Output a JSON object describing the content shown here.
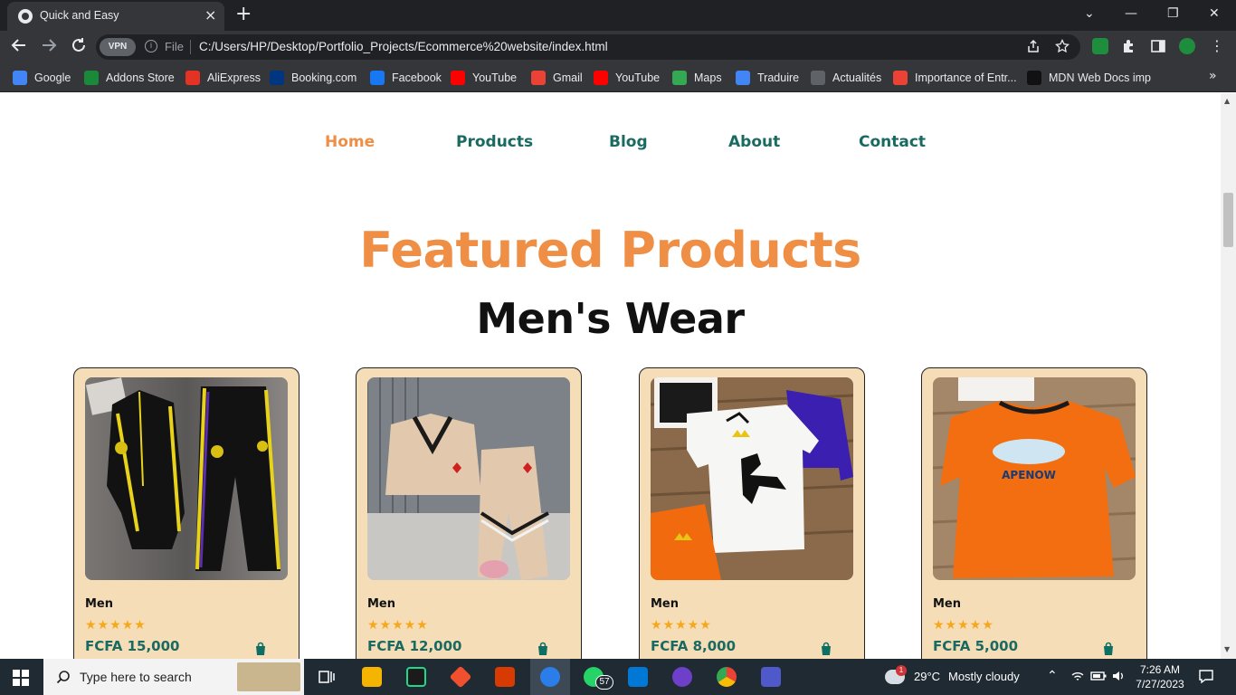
{
  "browser": {
    "tab_title": "Quick and Easy",
    "tab_close": "×",
    "new_tab": "+",
    "win_min": "—",
    "win_restore": "❐",
    "win_close": "✕",
    "win_dropdown": "⌄",
    "vpn": "VPN",
    "file_label": "File",
    "url": "C:/Users/HP/Desktop/Portfolio_Projects/Ecommerce%20website/index.html",
    "more_bookmarks": "»"
  },
  "bookmarks": [
    {
      "label": "Google",
      "icon": "google-icon",
      "color": "#4285f4"
    },
    {
      "label": "Addons Store",
      "icon": "addons-store-icon",
      "color": "#1a8a3a"
    },
    {
      "label": "AliExpress",
      "icon": "aliexpress-icon",
      "color": "#e43225"
    },
    {
      "label": "Booking.com",
      "icon": "booking-icon",
      "color": "#003580"
    },
    {
      "label": "Facebook",
      "icon": "facebook-icon",
      "color": "#1877f2"
    },
    {
      "label": "YouTube",
      "icon": "youtube-icon",
      "color": "#ff0000"
    },
    {
      "label": "Gmail",
      "icon": "gmail-icon",
      "color": "#ea4335"
    },
    {
      "label": "YouTube",
      "icon": "youtube-icon",
      "color": "#ff0000"
    },
    {
      "label": "Maps",
      "icon": "maps-icon",
      "color": "#34a853"
    },
    {
      "label": "Traduire",
      "icon": "translate-icon",
      "color": "#4285f4"
    },
    {
      "label": "Actualités",
      "icon": "news-icon",
      "color": "#5f6368"
    },
    {
      "label": "Importance of Entr...",
      "icon": "gmail-icon",
      "color": "#ea4335"
    },
    {
      "label": "MDN Web Docs imp",
      "icon": "mdn-icon",
      "color": "#111111"
    }
  ],
  "site": {
    "nav": [
      "Home",
      "Products",
      "Blog",
      "About",
      "Contact"
    ],
    "title": "Featured Products",
    "subtitle": "Men's Wear",
    "accent": "#ef8e45",
    "teal": "#1b6a62",
    "card_bg": "#f5ddb7"
  },
  "products": [
    {
      "brand": "Men",
      "stars": "★★★★★",
      "price": "FCFA 15,000",
      "image": "black-tracksuit"
    },
    {
      "brand": "Men",
      "stars": "★★★★★",
      "price": "FCFA 12,000",
      "image": "beige-set"
    },
    {
      "brand": "Men",
      "stars": "★★★★★",
      "price": "FCFA 8,000",
      "image": "dino-tshirts"
    },
    {
      "brand": "Men",
      "stars": "★★★★★",
      "price": "FCFA 5,000",
      "image": "orange-tshirt"
    }
  ],
  "taskbar": {
    "search_placeholder": "Type here to search",
    "whatsapp_badge": "57",
    "weather_temp": "29°C",
    "weather_text": "Mostly cloudy",
    "time": "7:26 AM",
    "date": "7/27/2023",
    "notification_badge": "1"
  }
}
